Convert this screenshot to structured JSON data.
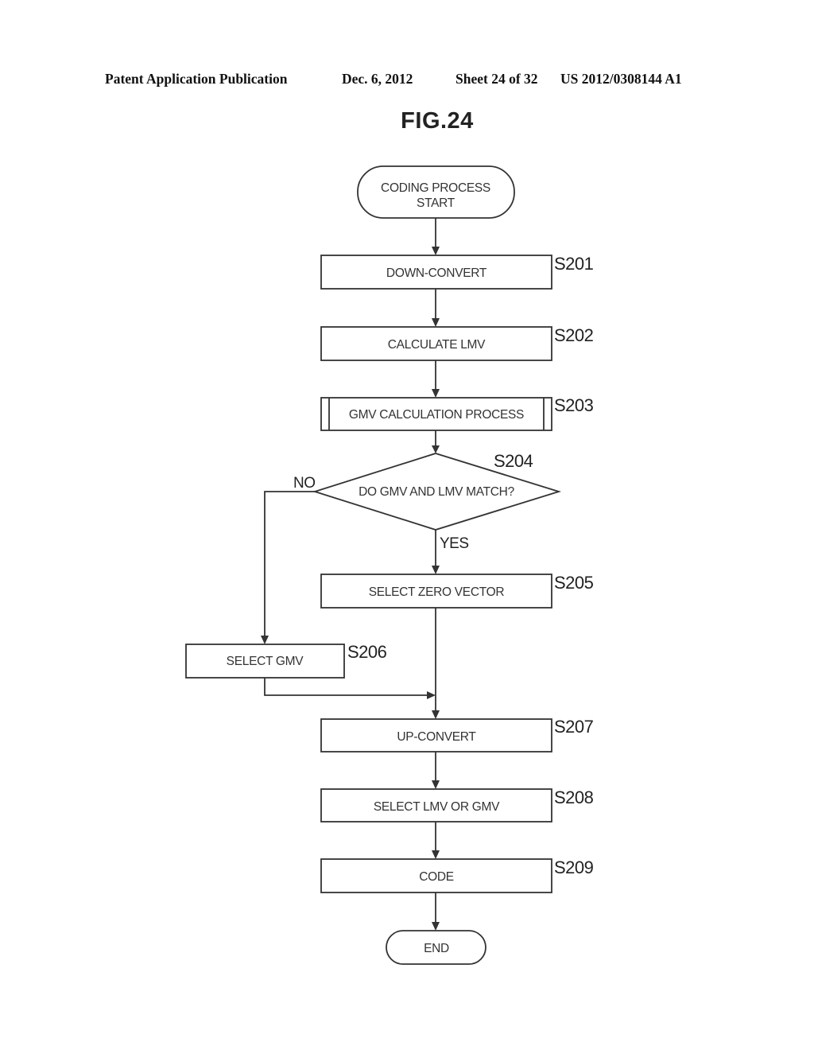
{
  "header": {
    "publication": "Patent Application Publication",
    "date": "Dec. 6, 2012",
    "sheet": "Sheet 24 of 32",
    "number": "US 2012/0308144 A1"
  },
  "figure": {
    "title": "FIG.24"
  },
  "flowchart": {
    "start": {
      "line1": "CODING PROCESS",
      "line2": "START"
    },
    "steps": [
      {
        "id": "S201",
        "label": "DOWN-CONVERT"
      },
      {
        "id": "S202",
        "label": "CALCULATE LMV"
      },
      {
        "id": "S203",
        "label": "GMV CALCULATION PROCESS"
      },
      {
        "id": "S204",
        "label": "DO GMV AND LMV MATCH?"
      },
      {
        "id": "S205",
        "label": "SELECT ZERO VECTOR"
      },
      {
        "id": "S206",
        "label": "SELECT GMV"
      },
      {
        "id": "S207",
        "label": "UP-CONVERT"
      },
      {
        "id": "S208",
        "label": "SELECT LMV OR GMV"
      },
      {
        "id": "S209",
        "label": "CODE"
      }
    ],
    "branch_no": "NO",
    "branch_yes": "YES",
    "end": "END"
  }
}
